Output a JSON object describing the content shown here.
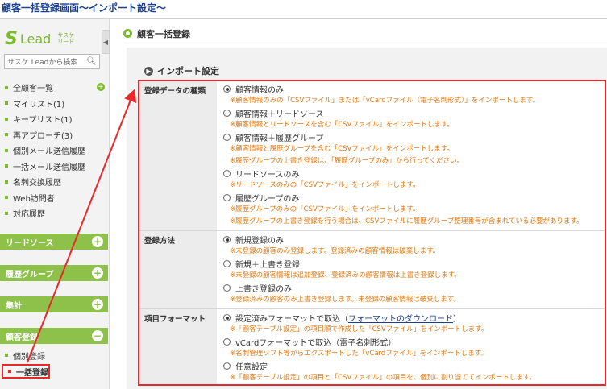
{
  "caption": "顧客一括登録画面〜インポート設定〜",
  "sidebar": {
    "logo": {
      "mark": "S",
      "text": "Lead",
      "sub": "サスケ リード"
    },
    "search": {
      "placeholder": "サスケ Leadから検索"
    },
    "items": [
      {
        "label": "全顧客一覧"
      },
      {
        "label": "マイリスト(1)"
      },
      {
        "label": "キープリスト(1)"
      },
      {
        "label": "再アプローチ(3)"
      },
      {
        "label": "個別メール送信履歴"
      },
      {
        "label": "一括メール送信履歴"
      },
      {
        "label": "名刺交換履歴"
      },
      {
        "label": "Web訪問者"
      },
      {
        "label": "対応履歴"
      }
    ],
    "sections": [
      {
        "label": "リードソース",
        "btn": "+"
      },
      {
        "label": "履歴グループ",
        "btn": "+"
      },
      {
        "label": "集計",
        "btn": "+"
      },
      {
        "label": "顧客登録",
        "btn": "−"
      }
    ],
    "sub_items": [
      {
        "label": "個別登録"
      },
      {
        "label": "一括登録"
      }
    ]
  },
  "main": {
    "page_title": "顧客一括登録",
    "section_title": "インポート設定",
    "rows": [
      {
        "label": "登録データの種類",
        "options": [
          {
            "text": "顧客情報のみ",
            "selected": true,
            "notes": [
              "※顧客情報のみの「CSVファイル」または「vCardファイル（電子名刺形式）」をインポートします。"
            ]
          },
          {
            "text": "顧客情報＋リードソース",
            "selected": false,
            "notes": [
              "※顧客情報とリードソースを含む「CSVファイル」をインポートします。"
            ]
          },
          {
            "text": "顧客情報＋履歴グループ",
            "selected": false,
            "notes": [
              "※顧客情報と履歴グループを含む「CSVファイル」をインポートします。",
              "※履歴グループの上書き登録は、「履歴グループのみ」から行ってください。"
            ]
          },
          {
            "text": "リードソースのみ",
            "selected": false,
            "notes": [
              "※リードソースのみの「CSVファイル」をインポートします。"
            ]
          },
          {
            "text": "履歴グループのみ",
            "selected": false,
            "notes": [
              "※履歴グループのみの「CSVファイル」をインポートします。",
              "※履歴グループの上書き登録を行う場合は、CSVファイルに履歴グループ整理番号が含まれている必要があります。"
            ]
          }
        ]
      },
      {
        "label": "登録方法",
        "options": [
          {
            "text": "新規登録のみ",
            "selected": true,
            "notes": [
              "※未登録の顧客のみ登録します。登録済みの顧客情報は破棄します。"
            ]
          },
          {
            "text": "新規＋上書き登録",
            "selected": false,
            "notes": [
              "※未登録の顧客情報は追加登録、登録済みの顧客情報は上書き登録します。"
            ]
          },
          {
            "text": "上書き登録のみ",
            "selected": false,
            "notes": [
              "※登録済みの顧客のみ上書き登録します。未登録の顧客情報は破棄します。"
            ]
          }
        ]
      },
      {
        "label": "項目フォーマット",
        "options": [
          {
            "text": "設定済みフォーマットで取込（",
            "link": "フォーマットのダウンロード",
            "suffix": "）",
            "selected": true,
            "notes": [
              "※「顧客テーブル設定」の項目順で作成した「CSVファイル」をインポートします。"
            ]
          },
          {
            "text": "vCardフォーマットで取込（電子名刺形式）",
            "selected": false,
            "notes": [
              "※名刺管理ソフト等からエクスポートした「vCardファイル」をインポートします。"
            ]
          },
          {
            "text": "任意設定",
            "selected": false,
            "notes": [
              "※「顧客テーブル設定」の項目と「CSVファイル」の項目を、個別に割り当ててインポートします。"
            ]
          }
        ]
      }
    ]
  },
  "colors": {
    "accent": "#7cbb2a",
    "highlight": "#e8282b",
    "note": "#e07810",
    "caption": "#1a3f8c"
  }
}
